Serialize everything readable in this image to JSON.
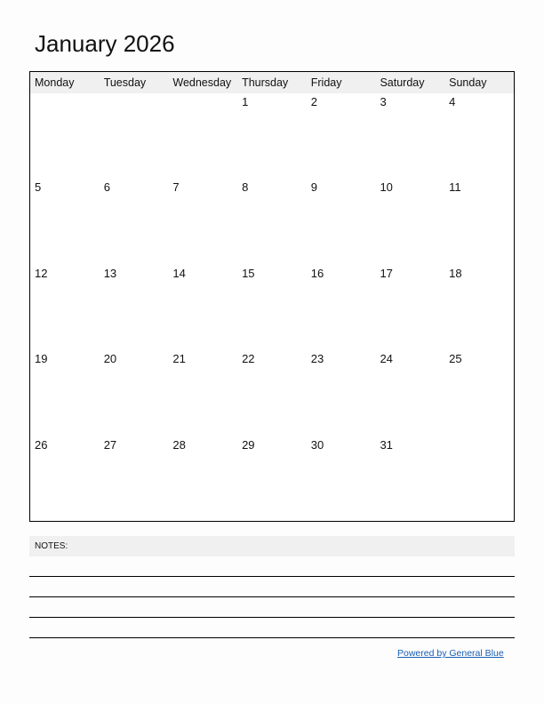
{
  "title": "January 2026",
  "weekdays": [
    "Monday",
    "Tuesday",
    "Wednesday",
    "Thursday",
    "Friday",
    "Saturday",
    "Sunday"
  ],
  "weeks": [
    [
      "",
      "",
      "",
      "1",
      "2",
      "3",
      "4"
    ],
    [
      "5",
      "6",
      "7",
      "8",
      "9",
      "10",
      "11"
    ],
    [
      "12",
      "13",
      "14",
      "15",
      "16",
      "17",
      "18"
    ],
    [
      "19",
      "20",
      "21",
      "22",
      "23",
      "24",
      "25"
    ],
    [
      "26",
      "27",
      "28",
      "29",
      "30",
      "31",
      ""
    ]
  ],
  "notes": {
    "label": "NOTES:",
    "line_count": 4
  },
  "footer": {
    "link_text": "Powered by General Blue",
    "color": "#1a5fb4"
  }
}
